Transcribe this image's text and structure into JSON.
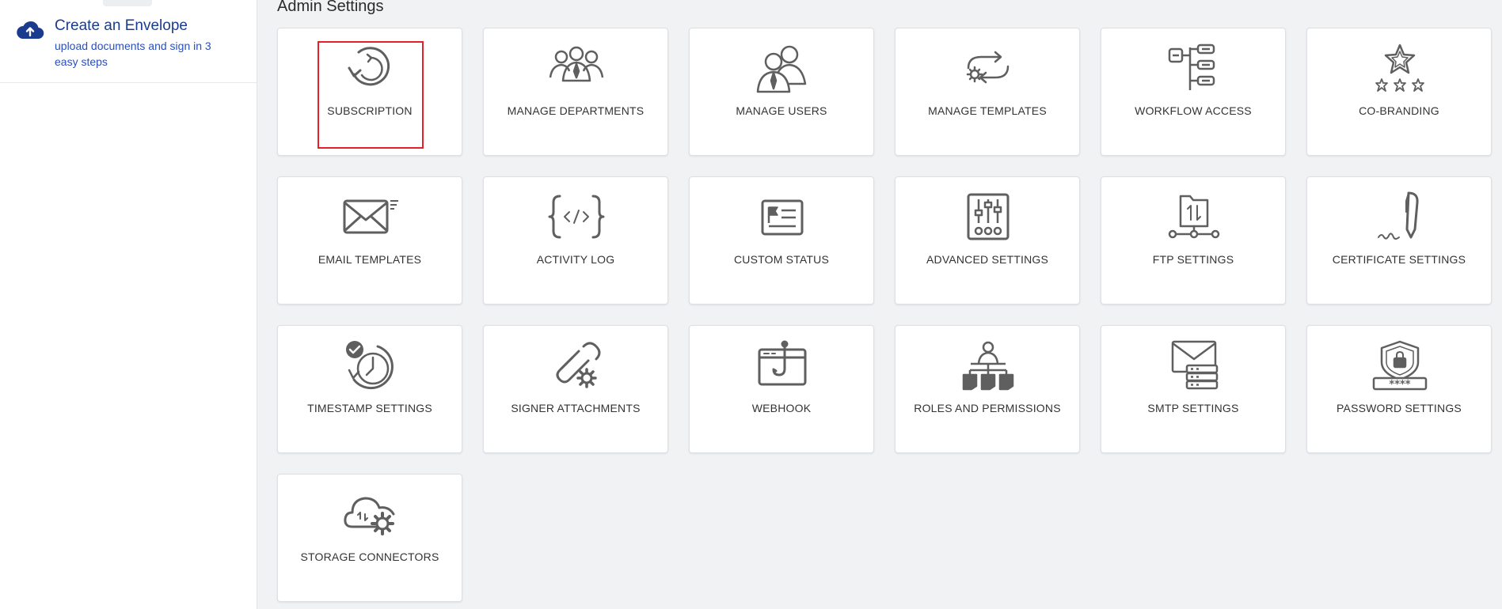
{
  "sidebar": {
    "create_envelope": {
      "title": "Create an Envelope",
      "subtitle": "upload documents and sign in 3 easy steps"
    }
  },
  "main": {
    "title": "Admin Settings",
    "tiles": [
      {
        "label": "SUBSCRIPTION",
        "icon": "subscription-icon"
      },
      {
        "label": "MANAGE DEPARTMENTS",
        "icon": "departments-icon"
      },
      {
        "label": "MANAGE USERS",
        "icon": "users-icon"
      },
      {
        "label": "MANAGE TEMPLATES",
        "icon": "templates-icon"
      },
      {
        "label": "WORKFLOW ACCESS",
        "icon": "workflow-icon"
      },
      {
        "label": "CO-BRANDING",
        "icon": "star-icon"
      },
      {
        "label": "EMAIL TEMPLATES",
        "icon": "envelope-icon"
      },
      {
        "label": "ACTIVITY LOG",
        "icon": "code-icon"
      },
      {
        "label": "CUSTOM STATUS",
        "icon": "status-card-icon"
      },
      {
        "label": "ADVANCED SETTINGS",
        "icon": "sliders-icon"
      },
      {
        "label": "FTP SETTINGS",
        "icon": "ftp-folder-icon"
      },
      {
        "label": "CERTIFICATE SETTINGS",
        "icon": "pen-signature-icon"
      },
      {
        "label": "TIMESTAMP SETTINGS",
        "icon": "clock-check-icon"
      },
      {
        "label": "SIGNER ATTACHMENTS",
        "icon": "paperclip-gear-icon"
      },
      {
        "label": "WEBHOOK",
        "icon": "webhook-icon"
      },
      {
        "label": "ROLES AND PERMISSIONS",
        "icon": "org-chart-icon"
      },
      {
        "label": "SMTP SETTINGS",
        "icon": "mail-server-icon"
      },
      {
        "label": "PASSWORD SETTINGS",
        "icon": "shield-lock-icon"
      },
      {
        "label": "STORAGE CONNECTORS",
        "icon": "cloud-gear-icon"
      }
    ]
  },
  "colors": {
    "brand_blue": "#1b3b8f",
    "link_blue": "#2a4fb8",
    "icon_gray": "#5f5f5f",
    "highlight_red": "#e5202b",
    "page_bg": "#f1f2f4"
  }
}
